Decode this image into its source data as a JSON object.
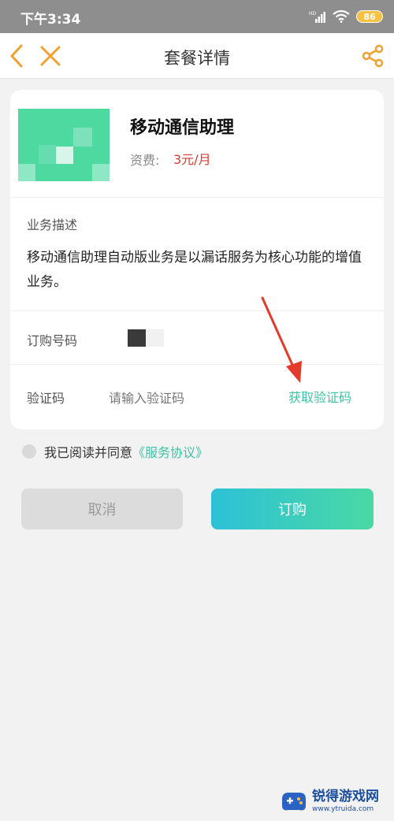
{
  "status_bar": {
    "time": "下午3:34",
    "network_badge": "HD",
    "battery": "86"
  },
  "header": {
    "title": "套餐详情",
    "back_icon": "chevron-left-icon",
    "close_icon": "close-icon",
    "share_icon": "share-icon"
  },
  "package": {
    "name": "移动通信助理",
    "fee_label": "资费:",
    "fee_value": "3元/月",
    "description_label": "业务描述",
    "description": "移动通信助理自动版业务是以漏话服务为核心功能的增值业务。"
  },
  "form": {
    "number_label": "订购号码",
    "code_label": "验证码",
    "code_placeholder": "请输入验证码",
    "get_code_label": "获取验证码"
  },
  "agreement": {
    "text": "我已阅读并同意",
    "link": "《服务协议》",
    "checked": false
  },
  "actions": {
    "cancel_label": "取消",
    "order_label": "订购"
  },
  "watermark": {
    "name": "锐得游戏网",
    "url": "www.ytruida.com"
  },
  "colors": {
    "accent": "#3ec4a4",
    "price": "#d93a2f",
    "header_icon": "#f0a030",
    "status_bar": "#8e8e8e"
  }
}
